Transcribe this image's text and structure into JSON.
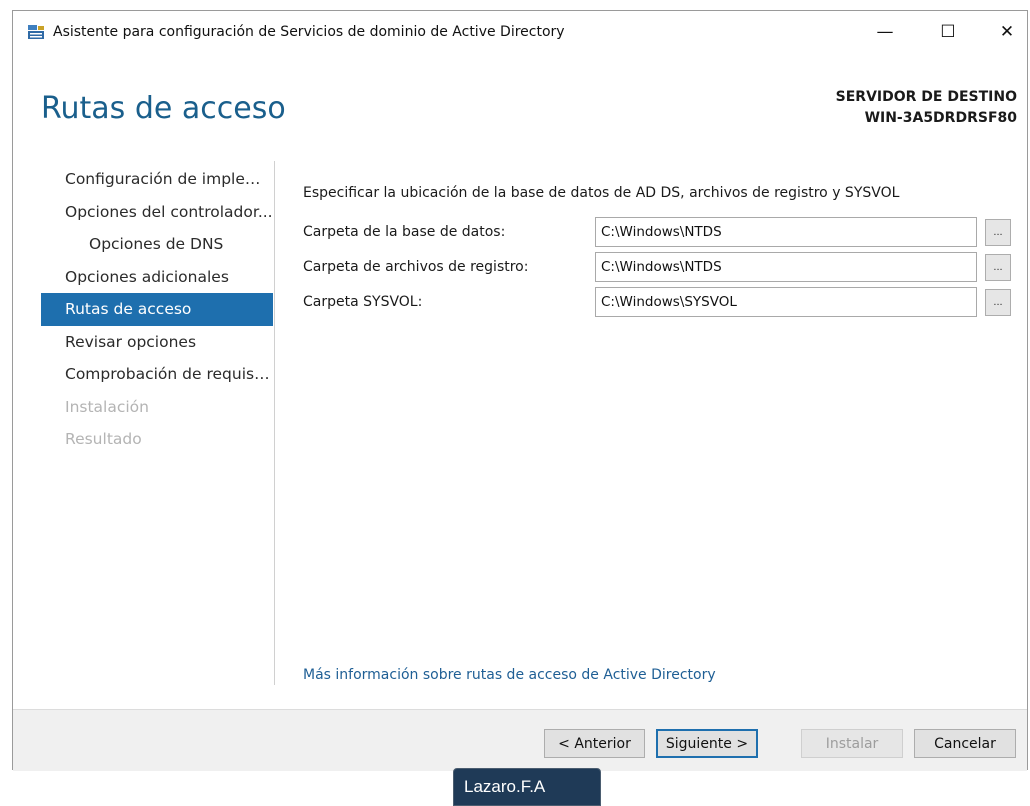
{
  "window": {
    "title": "Asistente para configuración de Servicios de dominio de Active Directory",
    "app_icon": "server-manager-icon",
    "controls": {
      "minimize": "—",
      "maximize": "☐",
      "close": "✕"
    }
  },
  "header": {
    "page_title": "Rutas de acceso",
    "server_label": "SERVIDOR DE DESTINO",
    "server_name": "WIN-3A5DRDRSF80"
  },
  "sidebar": {
    "items": [
      {
        "label": "Configuración de implem..."
      },
      {
        "label": "Opciones del controlador..."
      },
      {
        "label": "Opciones de DNS"
      },
      {
        "label": "Opciones adicionales"
      },
      {
        "label": "Rutas de acceso"
      },
      {
        "label": "Revisar opciones"
      },
      {
        "label": "Comprobación de requisi..."
      },
      {
        "label": "Instalación"
      },
      {
        "label": "Resultado"
      }
    ]
  },
  "main": {
    "description": "Especificar la ubicación de la base de datos de AD DS, archivos de registro y SYSVOL",
    "fields": [
      {
        "label": "Carpeta de la base de datos:",
        "value": "C:\\Windows\\NTDS"
      },
      {
        "label": "Carpeta de archivos de registro:",
        "value": "C:\\Windows\\NTDS"
      },
      {
        "label": "Carpeta SYSVOL:",
        "value": "C:\\Windows\\SYSVOL"
      }
    ],
    "browse_label": "...",
    "more_info_link": "Más información sobre rutas de acceso de Active Directory"
  },
  "footer": {
    "previous": "< Anterior",
    "next": "Siguiente >",
    "install": "Instalar",
    "cancel": "Cancelar"
  },
  "overlay": {
    "user_tag": "Lazaro.F.A"
  },
  "colors": {
    "accent": "#1e6fae",
    "heading": "#1a5f8c",
    "link": "#1f5f95"
  }
}
